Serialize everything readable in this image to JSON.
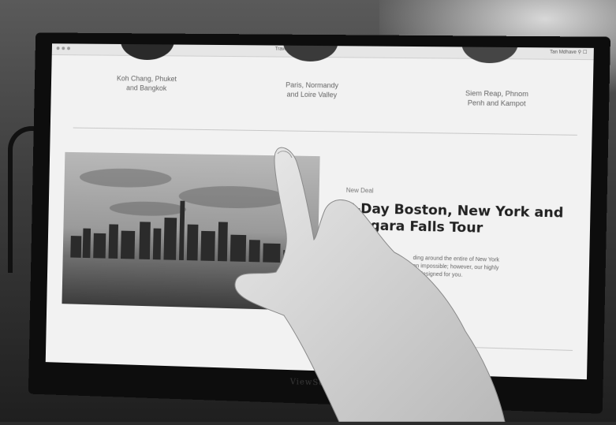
{
  "browser": {
    "tab_title": "Travel website",
    "user_label": "Tan Mdhave ⚲ ☐"
  },
  "destinations": [
    {
      "line1": "Koh Chang, Phuket",
      "line2": "and Bangkok"
    },
    {
      "line1": "Paris, Normandy",
      "line2": "and Loire Valley"
    },
    {
      "line1": "Siem Reap, Phnom",
      "line2": "Penh and Kampot"
    }
  ],
  "deal": {
    "label": "New Deal",
    "title_line1": "6-Day Boston, New York and",
    "title_line2": "Niagara Falls Tour",
    "body_line1": "ding around the entire of New York",
    "body_line2": "on impossible; however, our highly",
    "body_line3": "lly designed for you."
  },
  "monitor": {
    "brand": "ViewSonic"
  },
  "colors": {
    "screen_bg": "#f2f2f2",
    "bezel": "#0d0d0d",
    "title_text": "#222222"
  }
}
